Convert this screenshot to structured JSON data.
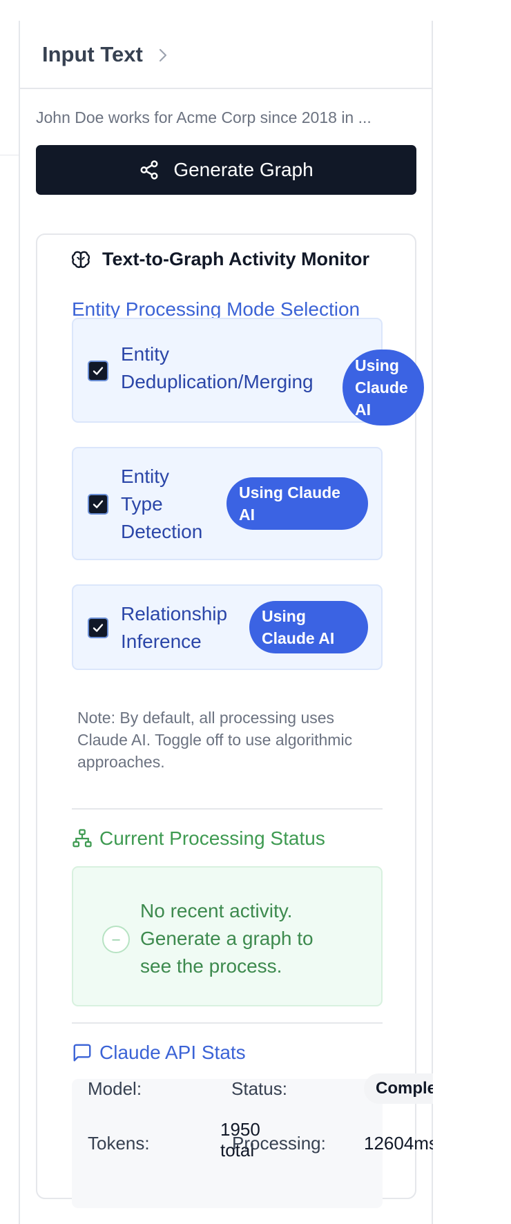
{
  "panel": {
    "title": "Input Text",
    "input_preview": "John Doe works for Acme Corp since 2018 in ...",
    "generate_button": "Generate Graph"
  },
  "monitor": {
    "title": "Text-to-Graph Activity Monitor",
    "mode_heading": "Entity Processing Mode Selection",
    "modes": [
      {
        "label_lines": [
          "Entity",
          "Deduplication/Merging"
        ],
        "badge": "Using Claude AI",
        "checked": true
      },
      {
        "label_lines": [
          "Entity",
          "Type",
          "Detection"
        ],
        "badge": "Using Claude AI",
        "checked": true
      },
      {
        "label_lines": [
          "Relationship",
          "Inference"
        ],
        "badge": "Using Claude AI",
        "checked": true
      }
    ],
    "note": "Note: By default, all processing uses Claude AI. Toggle off to use algorithmic approaches.",
    "status_heading": "Current Processing Status",
    "status_text": "No recent activity. Generate a graph to see the process.",
    "api_heading": "Claude API Stats",
    "api": {
      "model_label": "Model:",
      "status_label": "Status:",
      "status_value": "Complete",
      "tokens_label": "Tokens:",
      "tokens_value": "1950 total",
      "processing_label": "Processing:",
      "processing_value": "12604ms"
    }
  },
  "colors": {
    "accent": "#3b63e3",
    "dark_button": "#111827",
    "status_green": "#3e9a51"
  }
}
